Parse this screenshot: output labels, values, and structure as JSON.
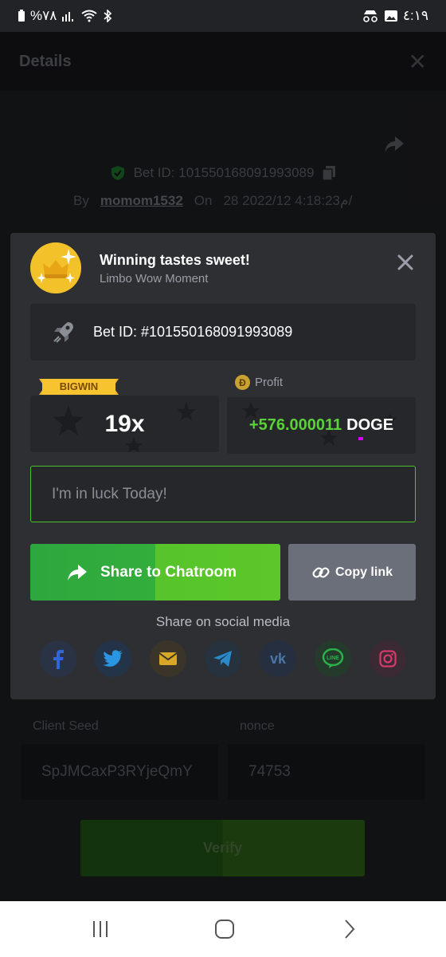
{
  "status_bar": {
    "battery": "%٧٨",
    "time": "٤:١٩"
  },
  "background": {
    "title": "Details",
    "bet_id": "Bet ID: 101550168091993089",
    "by_label": "By",
    "username": "momom1532",
    "on_label": "On",
    "date": "28 م4:18:23 2022/12/",
    "client_seed_label": "Client Seed",
    "client_seed_value": "SpJMCaxP3RYjeQmY",
    "nonce_label": "nonce",
    "nonce_value": "74753",
    "verify_label": "Verify"
  },
  "modal": {
    "title": "Winning tastes sweet!",
    "subtitle": "Limbo Wow Moment",
    "bet_id": "Bet ID: #101550168091993089",
    "badge": "BIGWIN",
    "multiplier": "19x",
    "profit_label": "Profit",
    "profit_amount": "+576.000011",
    "currency": "DOGE",
    "message_value": "I'm in luck Today!",
    "share_button": "Share to Chatroom",
    "copy_button": "Copy link",
    "social_title": "Share on social media",
    "social_icons": [
      "facebook-icon",
      "twitter-icon",
      "email-icon",
      "telegram-icon",
      "vk-icon",
      "line-icon",
      "instagram-icon"
    ]
  },
  "colors": {
    "accent_green": "#5ad23a",
    "brand_green": "#4bc22b",
    "bigwin_yellow": "#f3c22a"
  }
}
